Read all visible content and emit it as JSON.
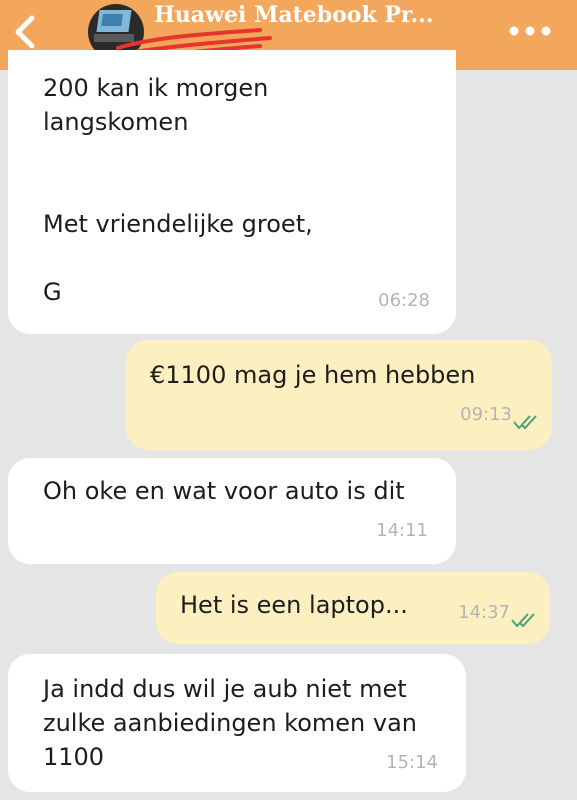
{
  "header": {
    "title": "Huawei Matebook Pr...",
    "bg_color": "#f2a75c",
    "back_icon": "chevron-left-icon",
    "menu_icon": "more-horizontal-icon"
  },
  "messages": [
    {
      "direction": "incoming",
      "text": "200 kan ik morgen\nlangskomen\n\n\nMet vriendelijke groet,\n\nG",
      "time": "06:28"
    },
    {
      "direction": "outgoing",
      "text": "€1100 mag je hem hebben",
      "time": "09:13",
      "status": "read"
    },
    {
      "direction": "incoming",
      "text": "Oh oke en wat voor auto is dit",
      "time": "14:11"
    },
    {
      "direction": "outgoing",
      "text": "Het is een laptop...",
      "time": "14:37",
      "status": "read"
    },
    {
      "direction": "incoming",
      "text": "Ja indd dus wil je aub niet met\nzulke aanbiedingen komen van\n1100",
      "time": "15:14"
    }
  ],
  "colors": {
    "incoming_bubble": "#ffffff",
    "outgoing_bubble": "#fdf0c0",
    "read_ticks": "#4aa07c",
    "background": "#e5e5e5"
  }
}
